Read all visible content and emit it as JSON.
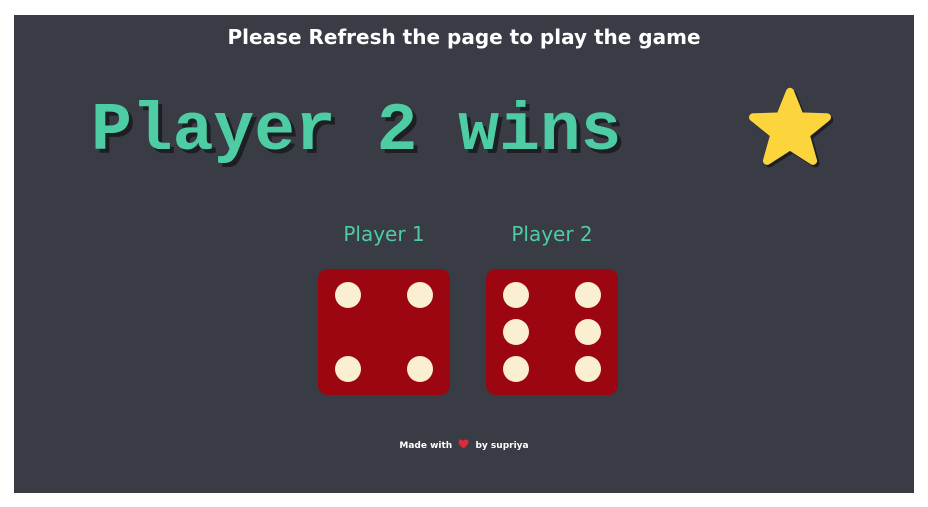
{
  "instruction": "Please Refresh the page to play the game",
  "result": {
    "text": "Player 2 wins",
    "icon": "star-icon",
    "icon_color": "#fcd43b"
  },
  "players": [
    {
      "label": "Player 1",
      "dice_value": 4
    },
    {
      "label": "Player 2",
      "dice_value": 6
    }
  ],
  "footer": {
    "prefix": "Made with",
    "icon": "heart-icon",
    "suffix": "by supriya"
  },
  "colors": {
    "background": "#393b45",
    "accent": "#4ecca3",
    "dice": "#9b0610",
    "dice_dot": "#fbefd2",
    "heart": "#e02a3a"
  }
}
